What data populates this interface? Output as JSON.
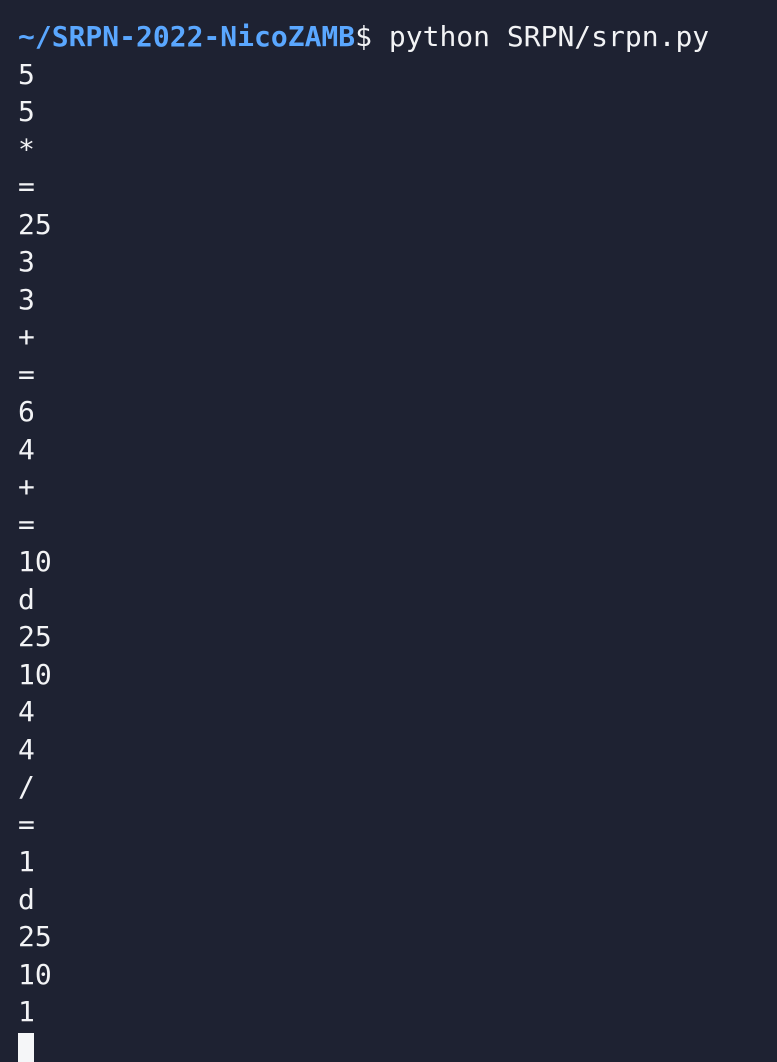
{
  "prompt": {
    "path": "~/SRPN-2022-NicoZAMB",
    "symbol": "$",
    "command": " python SRPN/srpn.py"
  },
  "lines": [
    "5",
    "5",
    "*",
    "=",
    "25",
    "3",
    "3",
    "+",
    "=",
    "6",
    "4",
    "+",
    "=",
    "10",
    "d",
    "25",
    "10",
    "4",
    "4",
    "/",
    "=",
    "1",
    "d",
    "25",
    "10",
    "1"
  ],
  "colors": {
    "background": "#1e2232",
    "prompt": "#5aa7ff",
    "text": "#f2f3f5",
    "cursor": "#f5f6f8"
  }
}
